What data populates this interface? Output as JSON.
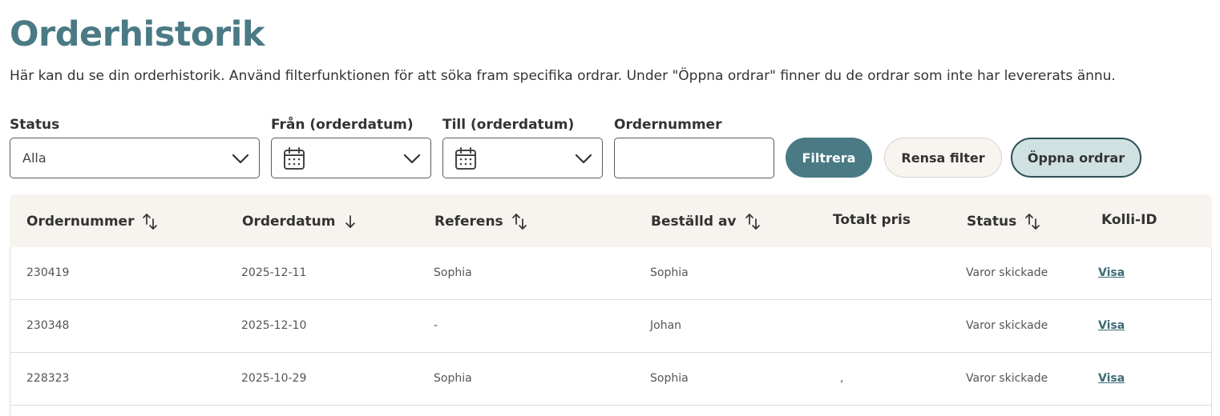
{
  "page": {
    "title": "Orderhistorik",
    "intro": "Här kan du se din orderhistorik. Använd filterfunktionen för att söka fram specifika ordrar. Under \"Öppna ordrar\" finner du de ordrar som inte har levererats ännu."
  },
  "filters": {
    "status": {
      "label": "Status",
      "value": "Alla"
    },
    "from": {
      "label": "Från (orderdatum)",
      "value": ""
    },
    "to": {
      "label": "Till (orderdatum)",
      "value": ""
    },
    "order_number": {
      "label": "Ordernummer",
      "value": "",
      "placeholder": ""
    }
  },
  "buttons": {
    "filter": "Filtrera",
    "clear": "Rensa filter",
    "open_orders": "Öppna ordrar"
  },
  "table": {
    "columns": [
      {
        "label": "Ordernummer",
        "sort": "both"
      },
      {
        "label": "Orderdatum",
        "sort": "desc"
      },
      {
        "label": "Referens",
        "sort": "both"
      },
      {
        "label": "Beställd av",
        "sort": "both"
      },
      {
        "label": "Totalt pris",
        "sort": "none"
      },
      {
        "label": "Status",
        "sort": "both"
      },
      {
        "label": "Kolli-ID",
        "sort": "none"
      }
    ],
    "rows": [
      {
        "order_number": "230419",
        "date": "2025-12-11",
        "reference": "Sophia",
        "ordered_by": "Sophia",
        "total": "",
        "status": "Varor skickade",
        "kolli": "Visa"
      },
      {
        "order_number": "230348",
        "date": "2025-12-10",
        "reference": "-",
        "ordered_by": "Johan",
        "total": "",
        "status": "Varor skickade",
        "kolli": "Visa"
      },
      {
        "order_number": "228323",
        "date": "2025-10-29",
        "reference": "Sophia",
        "ordered_by": "Sophia",
        "total": ",",
        "status": "Varor skickade",
        "kolli": "Visa"
      }
    ]
  },
  "colors": {
    "brand": "#4a7a84",
    "header_bg": "#f7f4f0",
    "link": "#3d6a75"
  }
}
